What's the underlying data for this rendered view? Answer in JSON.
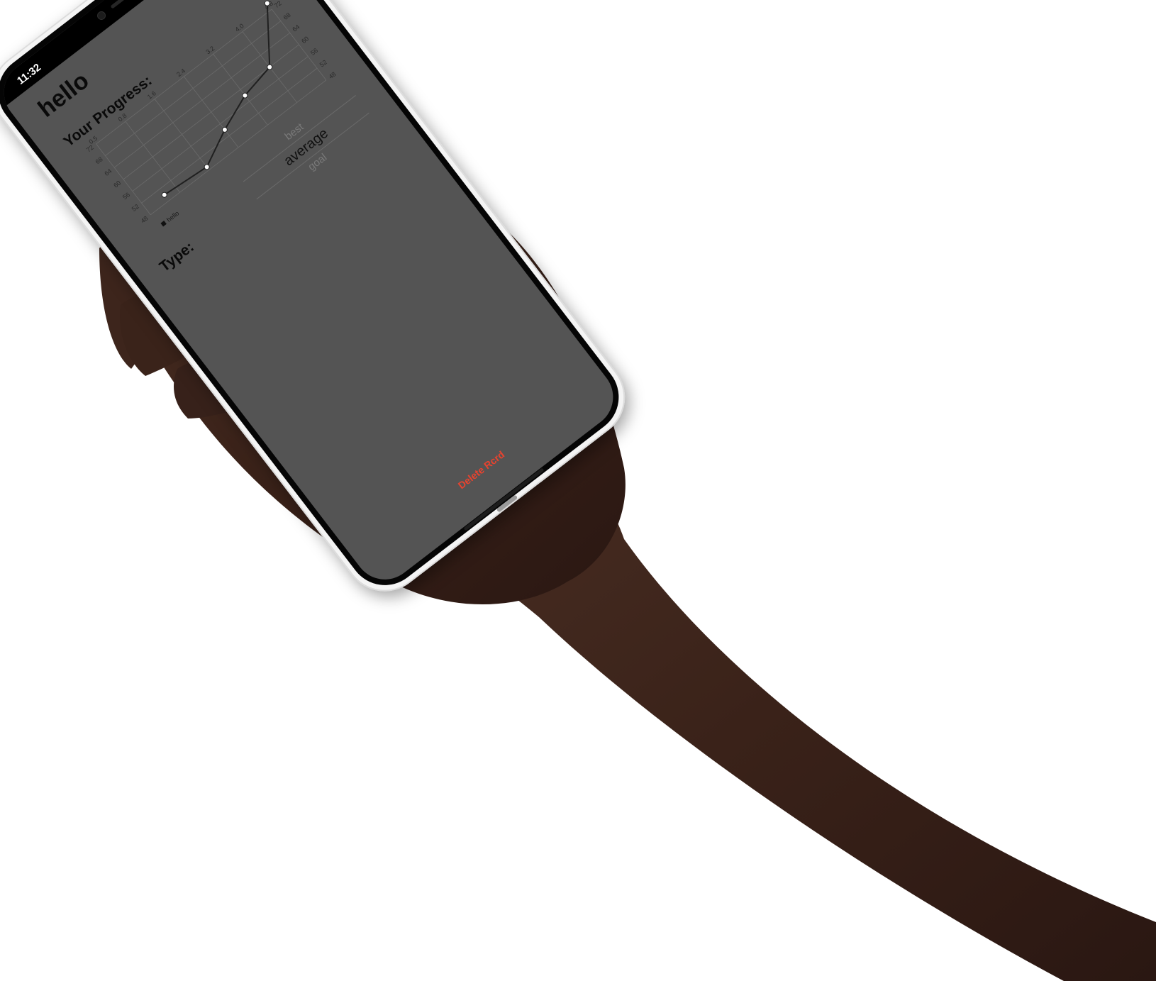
{
  "status_bar": {
    "time": "11:32",
    "icons": [
      "wifi-icon",
      "battery-icon"
    ]
  },
  "screen": {
    "title": "hello",
    "progress_heading": "Your Progress:",
    "type_label": "Type:",
    "picker_options": [
      "best",
      "average",
      "goal"
    ],
    "picker_selected": "average",
    "delete_label": "Delete Rcrd"
  },
  "colors": {
    "screen_background": "#545454",
    "delete_text": "#e8432f",
    "line": "#202020",
    "point": "#ffffff",
    "grid": "#6b6b6b"
  },
  "chart_data": {
    "type": "line",
    "x_ticks": [
      "0.5",
      "0.8",
      "1.6",
      "2.4",
      "3.2",
      "4.0",
      "4.8"
    ],
    "y_ticks_left": [
      "48",
      "52",
      "56",
      "60",
      "64",
      "68",
      "72"
    ],
    "y_ticks_right": [
      "48",
      "52",
      "56",
      "60",
      "64",
      "68",
      "72"
    ],
    "x": [
      0.5,
      1.6,
      2.4,
      3.2,
      4.0,
      4.8
    ],
    "series": [
      {
        "name": "hello",
        "values": [
          50,
          49,
          54,
          58,
          60,
          74
        ]
      }
    ],
    "xlim": [
      0,
      4.8
    ],
    "ylim": [
      48,
      72
    ],
    "legend_position": "bottom-left",
    "grid": true
  }
}
